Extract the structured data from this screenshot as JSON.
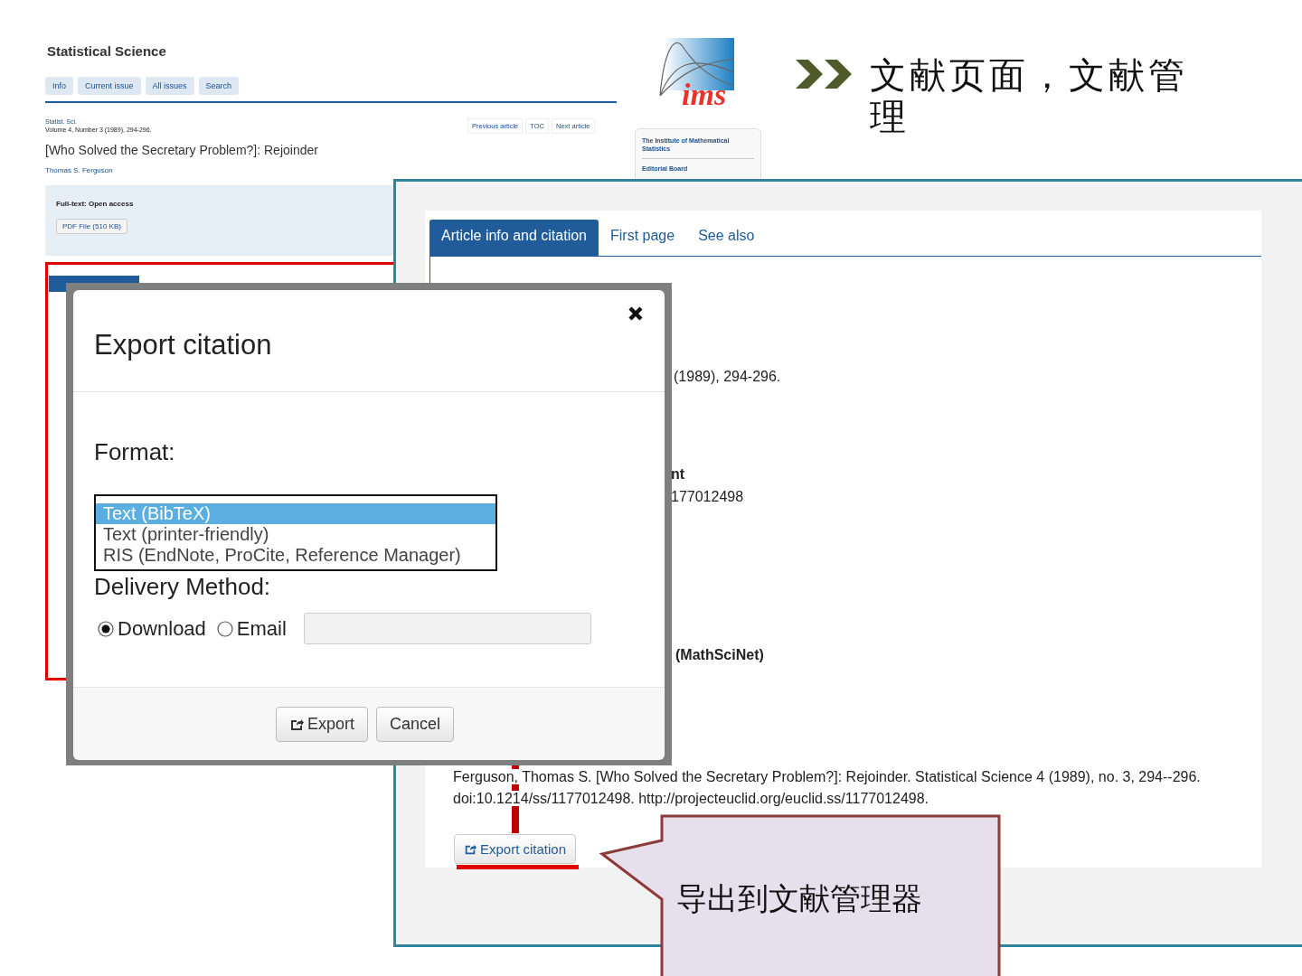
{
  "heading": {
    "title": "文献页面，文献管理"
  },
  "journal_page": {
    "title": "Statistical Science",
    "nav_tabs": [
      "Info",
      "Current issue",
      "All issues",
      "Search"
    ],
    "citation_source": "Statist. Sci.",
    "volume_line": "Volume 4, Number 3 (1989), 294-296.",
    "article_nav": [
      "Previous article",
      "TOC",
      "Next article"
    ],
    "article_title": "[Who Solved the Secretary Problem?]: Rejoinder",
    "author": "Thomas S. Ferguson",
    "fulltext_label": "Full-text: Open access",
    "pdf_button": "PDF File (510 KB)",
    "logo_text": "ims",
    "sidebar_links": [
      "The Institute of Mathematical Statistics",
      "Editorial Board"
    ]
  },
  "article_panel": {
    "tabs": [
      {
        "label": "Article info and citation",
        "selected": true
      },
      {
        "label": "First page",
        "selected": false
      },
      {
        "label": "See also",
        "selected": false
      }
    ],
    "fragments": [
      {
        "text": "(1989), 294-296.",
        "bold": false
      },
      {
        "text": "nt",
        "bold": true
      },
      {
        "text": "177012498",
        "bold": false
      },
      {
        "text": "(MathSciNet)",
        "bold": true
      }
    ],
    "citation": "Ferguson, Thomas S. [Who Solved the Secretary Problem?]: Rejoinder. Statistical Science 4 (1989), no. 3, 294--296. doi:10.1214/ss/1177012498. http://projecteuclid.org/euclid.ss/1177012498.",
    "export_button": "Export citation"
  },
  "dialog": {
    "title": "Export citation",
    "format_label": "Format:",
    "formats": [
      {
        "label": "Text (BibTeX)",
        "selected": true
      },
      {
        "label": "Text (printer-friendly)",
        "selected": false
      },
      {
        "label": "RIS (EndNote, ProCite, Reference Manager)",
        "selected": false
      }
    ],
    "delivery_label": "Delivery Method:",
    "delivery_options": [
      {
        "label": "Download",
        "selected": true
      },
      {
        "label": "Email",
        "selected": false
      }
    ],
    "buttons": [
      {
        "label": "Export",
        "kind": "export"
      },
      {
        "label": "Cancel",
        "kind": "plain"
      }
    ]
  },
  "callout": {
    "text": "导出到文献管理器"
  }
}
